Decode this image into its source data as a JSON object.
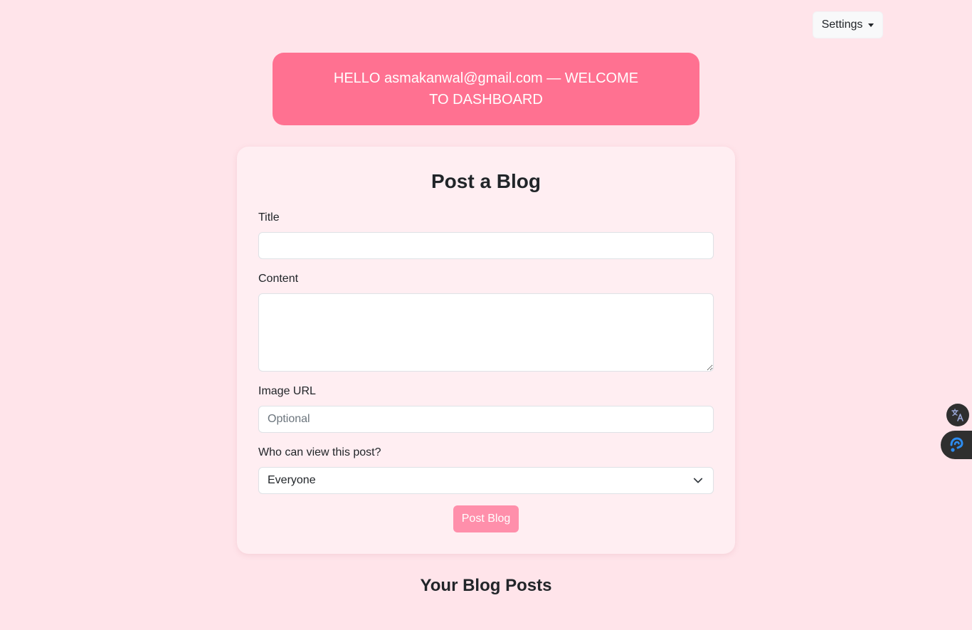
{
  "header": {
    "settings_label": "Settings"
  },
  "welcome": {
    "text": "HELLO asmakanwal@gmail.com — WELCOME TO DASHBOARD"
  },
  "form": {
    "title": "Post a Blog",
    "title_label": "Title",
    "title_value": "",
    "content_label": "Content",
    "content_value": "",
    "image_label": "Image URL",
    "image_placeholder": "Optional",
    "visibility_label": "Who can view this post?",
    "visibility_value": "Everyone",
    "submit_label": "Post Blog"
  },
  "posts": {
    "heading": "Your Blog Posts"
  },
  "side_widgets": {
    "translate_icon": "translate-icon",
    "assistant_icon": "assistant-icon"
  },
  "colors": {
    "page_background": "#ffe4ea",
    "welcome_banner": "#ff7191",
    "card_background": "#ffeef2",
    "submit_button": "#ff8fab"
  }
}
